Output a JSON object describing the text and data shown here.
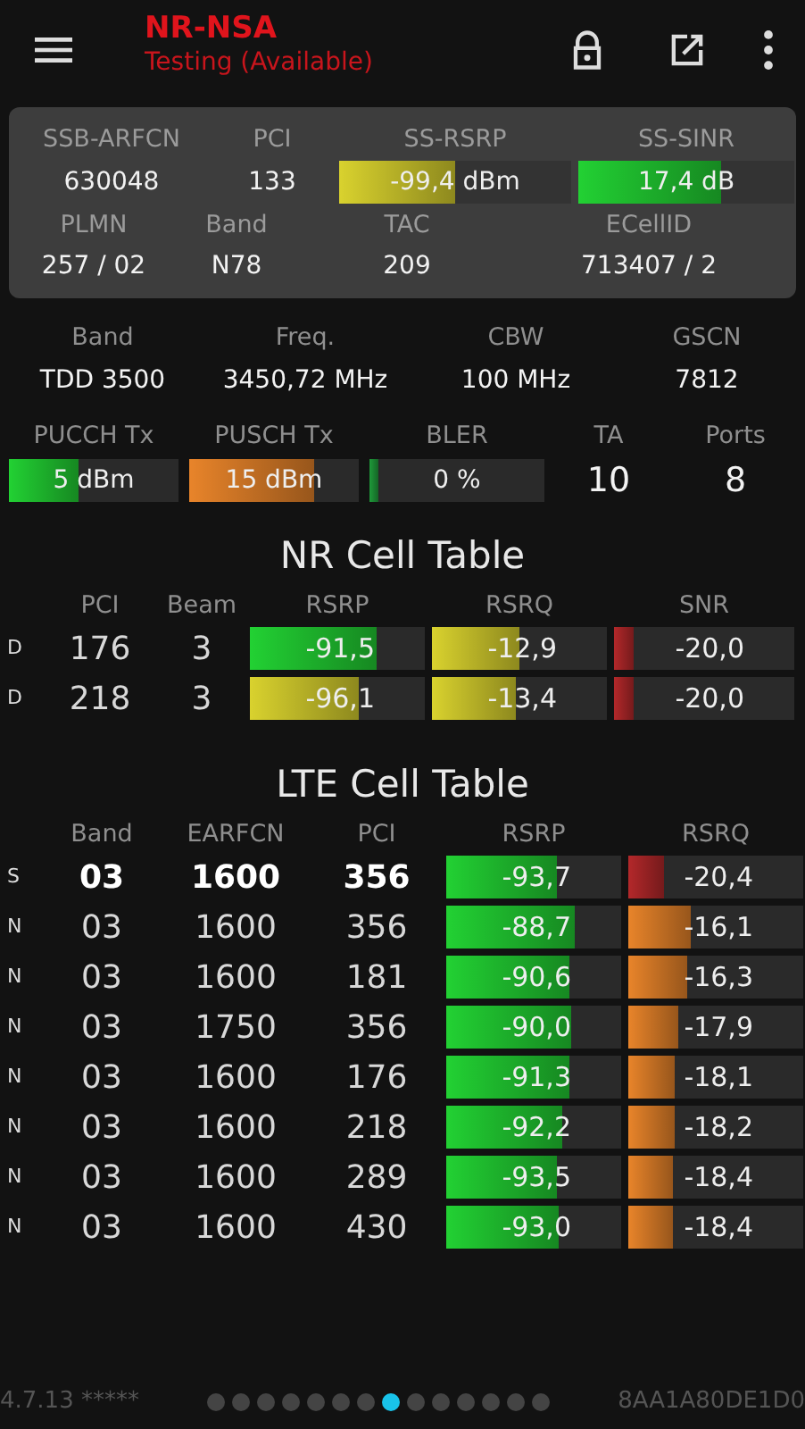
{
  "app_bar": {
    "title": "NR-NSA",
    "subtitle": "Testing (Available)"
  },
  "nr_summary": {
    "rows": [
      {
        "cells": [
          {
            "label": "SSB-ARFCN",
            "value": "630048"
          },
          {
            "label": "PCI",
            "value": "133"
          },
          {
            "label": "SS-RSRP",
            "value": "-99,4 dBm",
            "level": 0.5,
            "color": "#d9d22e"
          },
          {
            "label": "SS-SINR",
            "value": "17,4 dB",
            "level": 0.66,
            "color": "#22d133"
          }
        ]
      },
      {
        "cells": [
          {
            "label": "PLMN",
            "value": "257 / 02"
          },
          {
            "label": "Band",
            "value": "N78"
          },
          {
            "label": "TAC",
            "value": "209"
          },
          {
            "label": "ECellID",
            "value": "713407 / 2"
          }
        ]
      }
    ]
  },
  "details": {
    "rows": [
      {
        "cells": [
          {
            "label": "Band",
            "value": "TDD 3500"
          },
          {
            "label": "Freq.",
            "value": "3450,72 MHz"
          },
          {
            "label": "CBW",
            "value": "100 MHz"
          },
          {
            "label": "GSCN",
            "value": "7812"
          }
        ]
      },
      {
        "cells": [
          {
            "label": "PUCCH Tx",
            "value": "5 dBm",
            "level": 0.41,
            "color": "#22d133"
          },
          {
            "label": "PUSCH Tx",
            "value": "15 dBm",
            "level": 0.74,
            "color": "#e8842a"
          },
          {
            "label": "BLER",
            "value": "0 %",
            "level": 0.05,
            "color": "#1f9a3a"
          },
          {
            "label": "TA",
            "value": "10"
          },
          {
            "label": "Ports",
            "value": "8"
          }
        ]
      }
    ]
  },
  "nr_cell_table": {
    "title": "NR Cell Table",
    "columns": [
      "PCI",
      "Beam",
      "RSRP",
      "RSRQ",
      "SNR"
    ],
    "rows": [
      {
        "flag": "D",
        "cells": [
          {
            "value": "176"
          },
          {
            "value": "3"
          },
          {
            "value": "-91,5",
            "level": 0.72,
            "color": "#22d133"
          },
          {
            "value": "-12,9",
            "level": 0.5,
            "color": "#d9d22e"
          },
          {
            "value": "-20,0",
            "level": 0.11,
            "color": "#b3282a"
          }
        ]
      },
      {
        "flag": "D",
        "cells": [
          {
            "value": "218"
          },
          {
            "value": "3"
          },
          {
            "value": "-96,1",
            "level": 0.62,
            "color": "#d9d22e"
          },
          {
            "value": "-13,4",
            "level": 0.48,
            "color": "#d9d22e"
          },
          {
            "value": "-20,0",
            "level": 0.11,
            "color": "#b3282a"
          }
        ]
      }
    ]
  },
  "lte_cell_table": {
    "title": "LTE Cell Table",
    "columns": [
      "Band",
      "EARFCN",
      "PCI",
      "RSRP",
      "RSRQ"
    ],
    "rows": [
      {
        "flag": "S",
        "kind": "serving",
        "cells": [
          {
            "value": "03"
          },
          {
            "value": "1600"
          },
          {
            "value": "356"
          },
          {
            "value": "-93,7",
            "level": 0.63,
            "color": "#22d133"
          },
          {
            "value": "-20,4",
            "level": 0.2,
            "color": "#b3282a"
          }
        ]
      },
      {
        "flag": "N",
        "kind": "neighbor",
        "cells": [
          {
            "value": "03"
          },
          {
            "value": "1600"
          },
          {
            "value": "356"
          },
          {
            "value": "-88,7",
            "level": 0.73,
            "color": "#22d133"
          },
          {
            "value": "-16,1",
            "level": 0.36,
            "color": "#e8842a"
          }
        ]
      },
      {
        "flag": "N",
        "kind": "neighbor",
        "cells": [
          {
            "value": "03"
          },
          {
            "value": "1600"
          },
          {
            "value": "181"
          },
          {
            "value": "-90,6",
            "level": 0.7,
            "color": "#22d133"
          },
          {
            "value": "-16,3",
            "level": 0.34,
            "color": "#e8842a"
          }
        ]
      },
      {
        "flag": "N",
        "kind": "neighbor",
        "cells": [
          {
            "value": "03"
          },
          {
            "value": "1750"
          },
          {
            "value": "356"
          },
          {
            "value": "-90,0",
            "level": 0.71,
            "color": "#22d133"
          },
          {
            "value": "-17,9",
            "level": 0.29,
            "color": "#e8842a"
          }
        ]
      },
      {
        "flag": "N",
        "kind": "neighbor",
        "cells": [
          {
            "value": "03"
          },
          {
            "value": "1600"
          },
          {
            "value": "176"
          },
          {
            "value": "-91,3",
            "level": 0.7,
            "color": "#22d133"
          },
          {
            "value": "-18,1",
            "level": 0.27,
            "color": "#e8842a"
          }
        ]
      },
      {
        "flag": "N",
        "kind": "neighbor",
        "cells": [
          {
            "value": "03"
          },
          {
            "value": "1600"
          },
          {
            "value": "218"
          },
          {
            "value": "-92,2",
            "level": 0.66,
            "color": "#22d133"
          },
          {
            "value": "-18,2",
            "level": 0.27,
            "color": "#e8842a"
          }
        ]
      },
      {
        "flag": "N",
        "kind": "neighbor",
        "cells": [
          {
            "value": "03"
          },
          {
            "value": "1600"
          },
          {
            "value": "289"
          },
          {
            "value": "-93,5",
            "level": 0.63,
            "color": "#22d133"
          },
          {
            "value": "-18,4",
            "level": 0.26,
            "color": "#e8842a"
          }
        ]
      },
      {
        "flag": "N",
        "kind": "neighbor",
        "cells": [
          {
            "value": "03"
          },
          {
            "value": "1600"
          },
          {
            "value": "430"
          },
          {
            "value": "-93,0",
            "level": 0.64,
            "color": "#22d133"
          },
          {
            "value": "-18,4",
            "level": 0.26,
            "color": "#e8842a"
          }
        ]
      }
    ]
  },
  "footer": {
    "version": "4.7.13 *****",
    "device_id": "8AA1A80DE1D0",
    "pages": [
      {
        "selected": false
      },
      {
        "selected": false
      },
      {
        "selected": false
      },
      {
        "selected": false
      },
      {
        "selected": false
      },
      {
        "selected": false
      },
      {
        "selected": false
      },
      {
        "selected": true
      },
      {
        "selected": false
      },
      {
        "selected": false
      },
      {
        "selected": false
      },
      {
        "selected": false
      },
      {
        "selected": false
      },
      {
        "selected": false
      }
    ]
  }
}
